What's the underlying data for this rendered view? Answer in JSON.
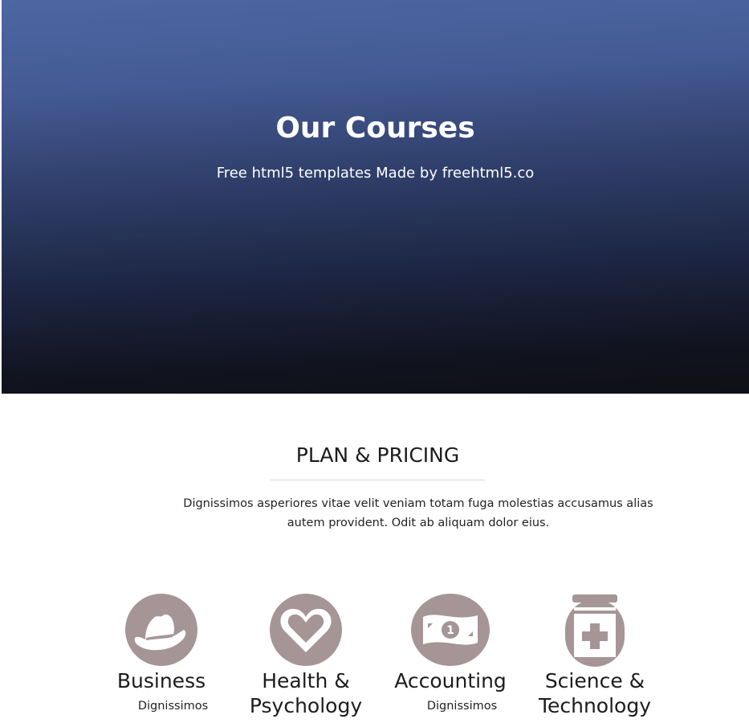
{
  "hero": {
    "title": "Our Courses",
    "subtitle": "Free html5 templates Made by freehtml5.co"
  },
  "pricing": {
    "title": "PLAN & PRICING",
    "description": "Dignissimos asperiores vitae velit veniam totam fuga molestias accusamus alias autem provident. Odit ab aliquam dolor eius."
  },
  "courses": [
    {
      "name": "Business",
      "desc": "Dignissimos",
      "icon": "hat-icon"
    },
    {
      "name": "Health & Psychology",
      "desc": "",
      "icon": "heart-icon"
    },
    {
      "name": "Accounting",
      "desc": "Dignissimos",
      "icon": "money-icon"
    },
    {
      "name": "Science & Technology",
      "desc": "",
      "icon": "medicine-icon"
    }
  ],
  "colors": {
    "icon_fill": "#a69597",
    "hero_top": "#4d67a3",
    "hero_bottom": "#0f0f17"
  }
}
